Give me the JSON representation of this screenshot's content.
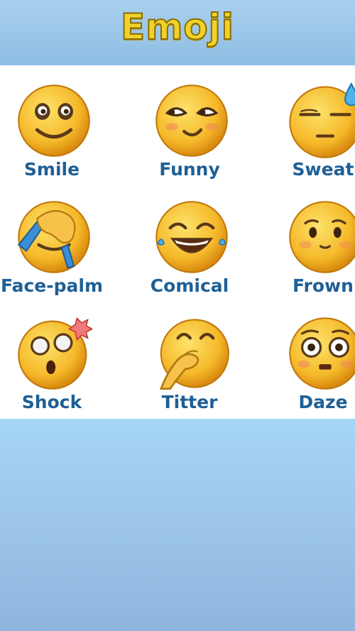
{
  "title": "Emoji",
  "colors": {
    "label": "#1f5f95",
    "title": "#f2d22a",
    "face": "#f6c12d"
  },
  "emojis": [
    {
      "label": "Smile",
      "icon": "smile-face-icon"
    },
    {
      "label": "Funny",
      "icon": "funny-face-icon"
    },
    {
      "label": "Sweat",
      "icon": "sweat-face-icon"
    },
    {
      "label": "Face-palm",
      "icon": "face-palm-icon"
    },
    {
      "label": "Comical",
      "icon": "comical-face-icon"
    },
    {
      "label": "Frown",
      "icon": "frown-face-icon"
    },
    {
      "label": "Shock",
      "icon": "shock-face-icon"
    },
    {
      "label": "Titter",
      "icon": "titter-face-icon"
    },
    {
      "label": "Daze",
      "icon": "daze-face-icon"
    }
  ]
}
